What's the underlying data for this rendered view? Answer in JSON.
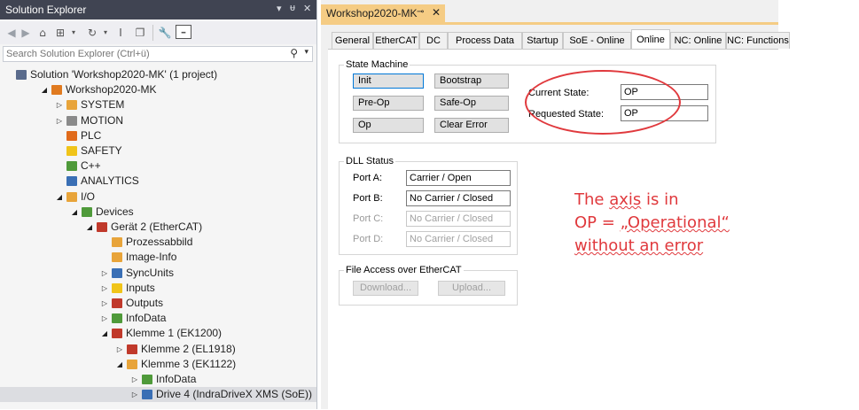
{
  "solution_explorer": {
    "title": "Solution Explorer",
    "title_controls": [
      "▾",
      "ᵾ",
      "✕"
    ],
    "search_placeholder": "Search Solution Explorer (Ctrl+ü)",
    "tree": [
      {
        "label": "Solution 'Workshop2020-MK' (1 project)",
        "indent": 0,
        "arrow": "",
        "icon": "solution-icon",
        "color": "#5a6b8c"
      },
      {
        "label": "Workshop2020-MK",
        "indent": 1,
        "arrow": "◢",
        "icon": "project-icon",
        "color": "#e07a1f"
      },
      {
        "label": "SYSTEM",
        "indent": 2,
        "arrow": "▷",
        "icon": "system-icon",
        "color": "#e8a43a"
      },
      {
        "label": "MOTION",
        "indent": 2,
        "arrow": "▷",
        "icon": "motion-icon",
        "color": "#8a8a8a"
      },
      {
        "label": "PLC",
        "indent": 2,
        "arrow": "",
        "icon": "plc-icon",
        "color": "#e06a1a"
      },
      {
        "label": "SAFETY",
        "indent": 2,
        "arrow": "",
        "icon": "safety-icon",
        "color": "#f0c419"
      },
      {
        "label": "C++",
        "indent": 2,
        "arrow": "",
        "icon": "cpp-icon",
        "color": "#4f9a3a"
      },
      {
        "label": "ANALYTICS",
        "indent": 2,
        "arrow": "",
        "icon": "analytics-icon",
        "color": "#3a6fb5"
      },
      {
        "label": "I/O",
        "indent": 2,
        "arrow": "◢",
        "icon": "io-icon",
        "color": "#e8a43a"
      },
      {
        "label": "Devices",
        "indent": 3,
        "arrow": "◢",
        "icon": "devices-icon",
        "color": "#4f9a3a"
      },
      {
        "label": "Gerät 2 (EtherCAT)",
        "indent": 4,
        "arrow": "◢",
        "icon": "ethercat-master-icon",
        "color": "#c0392b"
      },
      {
        "label": "Prozessabbild",
        "indent": 5,
        "arrow": "",
        "icon": "process-image-icon",
        "color": "#e8a43a"
      },
      {
        "label": "Image-Info",
        "indent": 5,
        "arrow": "",
        "icon": "image-info-icon",
        "color": "#e8a43a"
      },
      {
        "label": "SyncUnits",
        "indent": 5,
        "arrow": "▷",
        "icon": "syncunits-icon",
        "color": "#3a6fb5"
      },
      {
        "label": "Inputs",
        "indent": 5,
        "arrow": "▷",
        "icon": "inputs-icon",
        "color": "#f0c419"
      },
      {
        "label": "Outputs",
        "indent": 5,
        "arrow": "▷",
        "icon": "outputs-icon",
        "color": "#c0392b"
      },
      {
        "label": "InfoData",
        "indent": 5,
        "arrow": "▷",
        "icon": "infodata-icon",
        "color": "#4f9a3a"
      },
      {
        "label": "Klemme 1 (EK1200)",
        "indent": 5,
        "arrow": "◢",
        "icon": "terminal-icon",
        "color": "#c0392b"
      },
      {
        "label": "Klemme 2 (EL1918)",
        "indent": 6,
        "arrow": "▷",
        "icon": "terminal-icon",
        "color": "#c0392b"
      },
      {
        "label": "Klemme 3 (EK1122)",
        "indent": 6,
        "arrow": "◢",
        "icon": "terminal-icon",
        "color": "#e8a43a"
      },
      {
        "label": "InfoData",
        "indent": 7,
        "arrow": "▷",
        "icon": "infodata-icon",
        "color": "#4f9a3a"
      },
      {
        "label": "Drive 4 (IndraDriveX XMS (SoE))",
        "indent": 7,
        "arrow": "▷",
        "icon": "drive-icon",
        "color": "#3a6fb5",
        "selected": true
      }
    ]
  },
  "document": {
    "tab_title": "Workshop2020-MK",
    "pin": "⊸",
    "close": "✕",
    "tabs": [
      "General",
      "EtherCAT",
      "DC",
      "Process Data",
      "Startup",
      "SoE - Online",
      "Online",
      "NC: Online",
      "NC: Functions"
    ],
    "active_tab": "Online",
    "state_machine": {
      "legend": "State Machine",
      "buttons": [
        "Init",
        "Bootstrap",
        "Pre-Op",
        "Safe-Op",
        "Op",
        "Clear Error"
      ],
      "current_state_label": "Current State:",
      "current_state_value": "OP",
      "requested_state_label": "Requested State:",
      "requested_state_value": "OP"
    },
    "dll_status": {
      "legend": "DLL Status",
      "ports": [
        {
          "label": "Port A:",
          "value": "Carrier / Open",
          "enabled": true
        },
        {
          "label": "Port B:",
          "value": "No Carrier / Closed",
          "enabled": true
        },
        {
          "label": "Port C:",
          "value": "No Carrier / Closed",
          "enabled": false
        },
        {
          "label": "Port D:",
          "value": "No Carrier / Closed",
          "enabled": false
        }
      ]
    },
    "file_access": {
      "legend": "File Access over EtherCAT",
      "download": "Download...",
      "upload": "Upload..."
    }
  },
  "annotation": {
    "line1_pre": "The ",
    "line1_word": "axis",
    "line1_post": " is in",
    "line2_pre": "OP = ",
    "line2_word": "„Operational“",
    "line3": "without an error",
    "color": "#e0393d"
  }
}
